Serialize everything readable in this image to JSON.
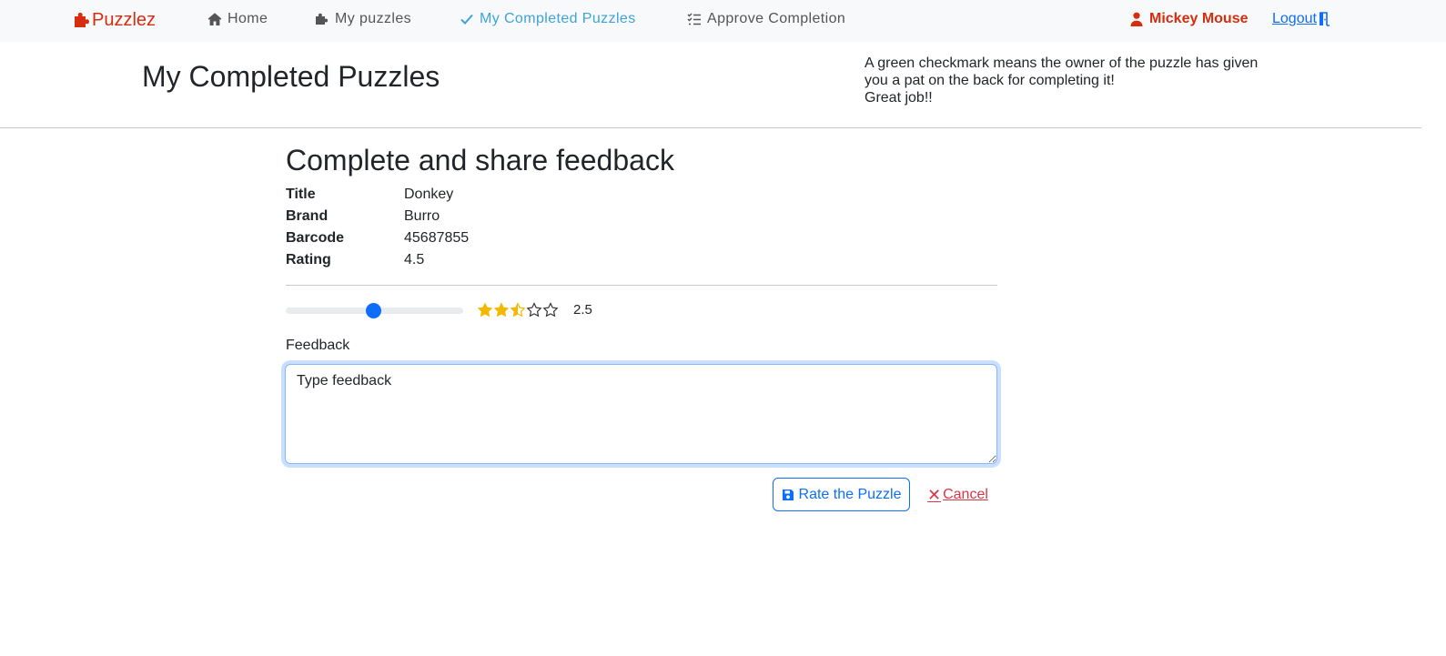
{
  "navbar": {
    "brand": "Puzzlez",
    "items": [
      {
        "label": "Home",
        "icon": "home-icon"
      },
      {
        "label": "My puzzles",
        "icon": "puzzle-piece-icon"
      },
      {
        "label": "My Completed Puzzles",
        "icon": "check-icon"
      },
      {
        "label": "Approve Completion",
        "icon": "list-check-icon"
      }
    ],
    "user_name": "Mickey Mouse",
    "logout_label": "Logout"
  },
  "header": {
    "title": "My Completed Puzzles",
    "note_lines": [
      "A green checkmark means the owner of the puzzle has given",
      "you a pat on the back for completing it!",
      "Great job!!"
    ]
  },
  "form": {
    "title": "Complete and share feedback",
    "details": [
      {
        "key": "Title",
        "value": "Donkey"
      },
      {
        "key": "Brand",
        "value": "Burro"
      },
      {
        "key": "Barcode",
        "value": "45687855"
      },
      {
        "key": "Rating",
        "value": "4.5"
      }
    ],
    "rating_slider": {
      "value": 2.5,
      "min": 0,
      "max": 5
    },
    "stars": {
      "filled": 2,
      "half": 1,
      "empty": 2,
      "color": "#f5b800"
    },
    "rating_display": "2.5",
    "feedback_label": "Feedback",
    "feedback_value": "Type feedback",
    "submit_label": "Rate the Puzzle",
    "cancel_label": "Cancel"
  },
  "colors": {
    "brand": "#d62d0f",
    "active_nav": "#3ea3da",
    "primary": "#0d6efd",
    "danger": "#dc3545"
  }
}
